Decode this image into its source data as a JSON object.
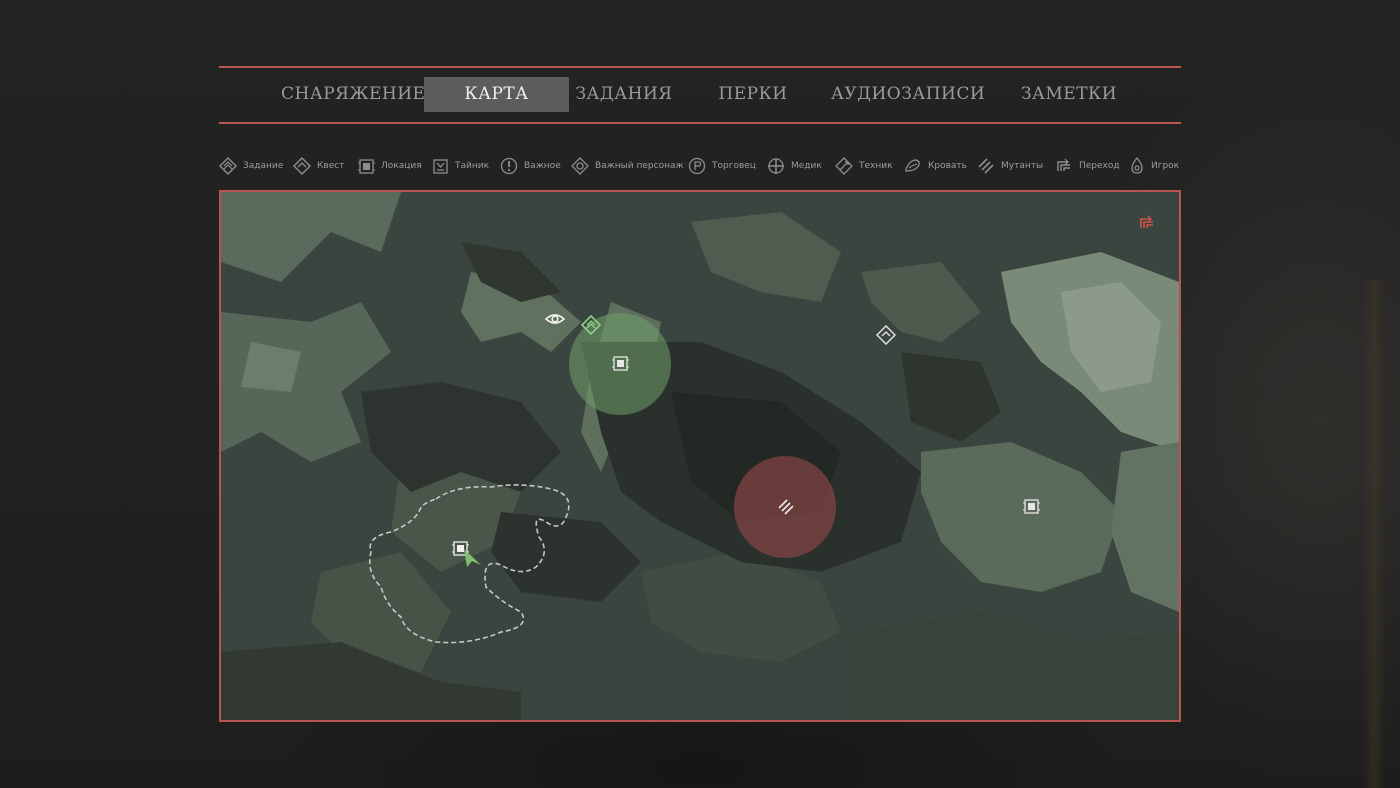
{
  "tabs": [
    {
      "label": "СНАРЯЖЕНИЕ",
      "active": false
    },
    {
      "label": "КАРТА",
      "active": true
    },
    {
      "label": "ЗАДАНИЯ",
      "active": false
    },
    {
      "label": "ПЕРКИ",
      "active": false
    },
    {
      "label": "АУДИОЗАПИСИ",
      "active": false
    },
    {
      "label": "ЗАМЕТКИ",
      "active": false
    }
  ],
  "legend": [
    {
      "label": "Задание",
      "icon": "task-icon"
    },
    {
      "label": "Квест",
      "icon": "quest-icon"
    },
    {
      "label": "Локация",
      "icon": "location-icon"
    },
    {
      "label": "Тайник",
      "icon": "stash-icon"
    },
    {
      "label": "Важное",
      "icon": "important-icon"
    },
    {
      "label": "Важный персонаж",
      "icon": "important-character-icon"
    },
    {
      "label": "Торговец",
      "icon": "trader-icon"
    },
    {
      "label": "Медик",
      "icon": "medic-icon"
    },
    {
      "label": "Техник",
      "icon": "technician-icon"
    },
    {
      "label": "Кровать",
      "icon": "bed-icon"
    },
    {
      "label": "Мутанты",
      "icon": "mutants-icon"
    },
    {
      "label": "Переход",
      "icon": "transition-icon"
    },
    {
      "label": "Игрок",
      "icon": "player-icon"
    }
  ],
  "colors": {
    "accent_border": "#b5574f",
    "active_tab_bg": "#5c5c5c",
    "safe_zone": "#6fa06a",
    "danger_zone": "#a04d4d",
    "player_arrow": "#7fbf6f"
  },
  "map_markers": [
    {
      "name": "important-character-marker",
      "icon": "important-character-icon"
    },
    {
      "name": "task-marker",
      "icon": "task-icon"
    },
    {
      "name": "location-marker-green-zone",
      "icon": "location-icon"
    },
    {
      "name": "quest-marker",
      "icon": "quest-icon"
    },
    {
      "name": "mutants-marker-red-zone",
      "icon": "mutants-icon"
    },
    {
      "name": "location-marker-east",
      "icon": "location-icon"
    },
    {
      "name": "location-marker-player",
      "icon": "location-icon"
    },
    {
      "name": "player-marker",
      "icon": "player-icon"
    },
    {
      "name": "transition-marker",
      "icon": "transition-icon"
    }
  ]
}
